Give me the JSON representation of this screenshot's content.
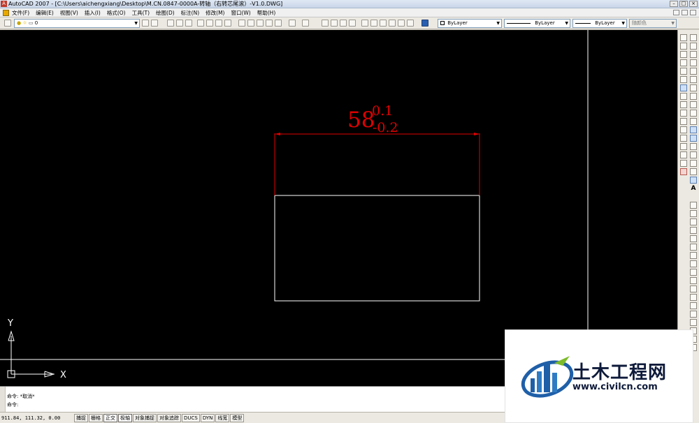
{
  "window": {
    "title": "AutoCAD 2007 - [C:\\Users\\aichengxiang\\Desktop\\M.CN.0847-0000A-转轴（右转芯尾滚）-V1.0.DWG]"
  },
  "menu": {
    "items": [
      "文件(F)",
      "编辑(E)",
      "视图(V)",
      "插入(I)",
      "格式(O)",
      "工具(T)",
      "绘图(D)",
      "标注(N)",
      "修改(M)",
      "窗口(W)",
      "帮助(H)"
    ]
  },
  "toolbar": {
    "layer_value": "0",
    "color_value": "ByLayer",
    "linetype_value": "ByLayer",
    "lineweight_value": "ByLayer",
    "plotstyle_value": "随颜色"
  },
  "drawing": {
    "dimension_main": "58",
    "tolerance_upper": "0.1",
    "tolerance_lower": "-0.2",
    "ucs_y_label": "Y",
    "ucs_x_label": "X",
    "colors": {
      "background": "#000000",
      "dimension": "#e00000",
      "geometry": "#ffffff"
    }
  },
  "command": {
    "line1_prompt": "命令:",
    "line1_text": "*取消*",
    "line2_prompt": "命令:"
  },
  "status": {
    "coords": "911.84, 111.32, 0.00",
    "toggles": [
      "捕捉",
      "栅格",
      "正交",
      "极轴",
      "对象捕捉",
      "对象追踪",
      "DUCS",
      "DYN",
      "线宽",
      "模型"
    ]
  },
  "watermark": {
    "brand_cn": "土木工程网",
    "url": "www.civilcn.com"
  },
  "right_toolbar": {
    "text_icon_letter": "A"
  }
}
